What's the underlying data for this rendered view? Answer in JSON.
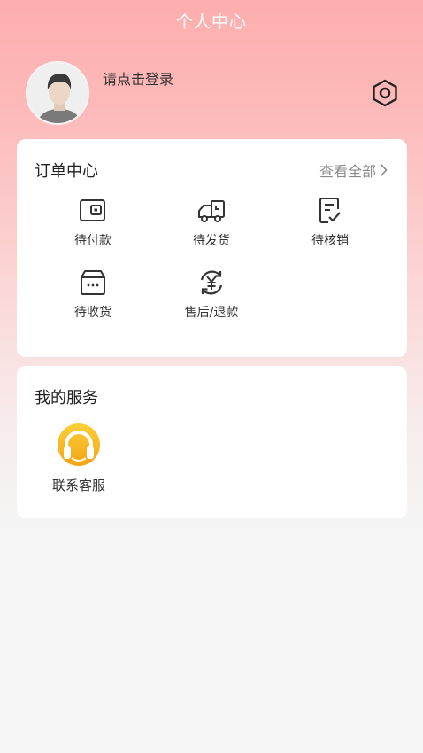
{
  "header": {
    "title": "个人中心"
  },
  "profile": {
    "login_prompt": "请点击登录"
  },
  "orders": {
    "title": "订单中心",
    "view_all": "查看全部",
    "items": [
      {
        "label": "待付款",
        "icon": "wallet-icon"
      },
      {
        "label": "待发货",
        "icon": "delivery-truck-icon"
      },
      {
        "label": "待核销",
        "icon": "checklist-icon"
      },
      {
        "label": "待收货",
        "icon": "box-icon"
      },
      {
        "label": "售后/退款",
        "icon": "refund-yen-icon"
      }
    ]
  },
  "services": {
    "title": "我的服务",
    "items": [
      {
        "label": "联系客服",
        "icon": "headset-icon"
      }
    ]
  },
  "colors": {
    "accent": "#fdaeae",
    "icon_stroke": "#333333",
    "service_icon": "#f7b51b"
  }
}
